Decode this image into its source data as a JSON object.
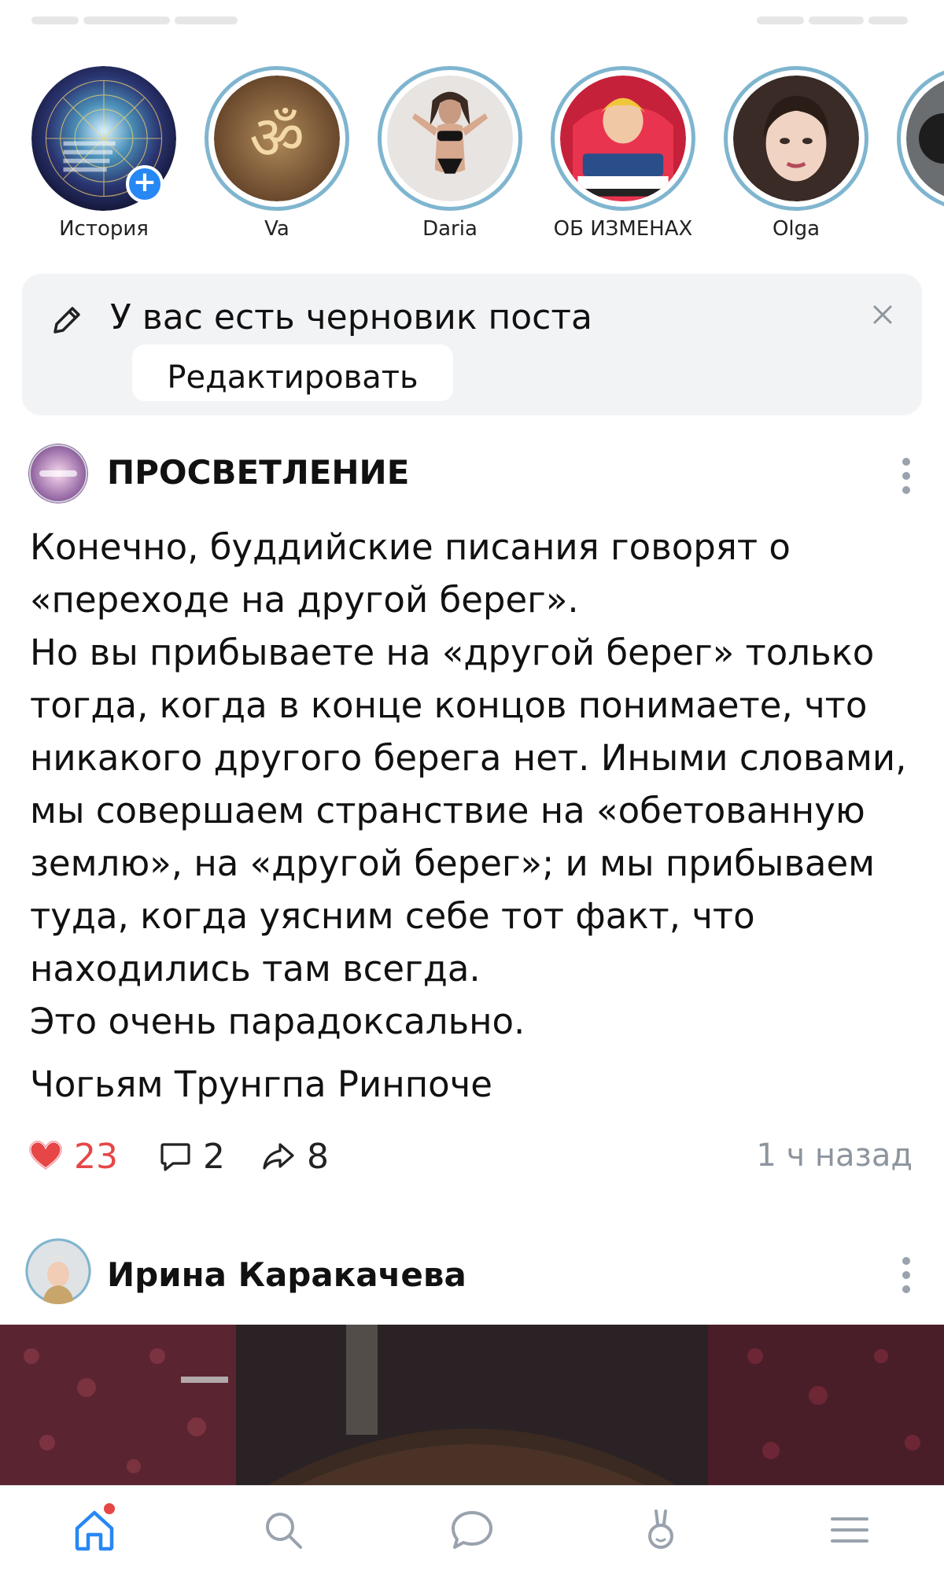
{
  "stories": [
    {
      "name": "История",
      "own": true
    },
    {
      "name": "Va"
    },
    {
      "name": "Daria"
    },
    {
      "name": "ОБ ИЗМЕНАХ"
    },
    {
      "name": "Olga"
    }
  ],
  "draft": {
    "text": "У вас есть черновик поста",
    "edit_label": "Редактировать"
  },
  "post": {
    "author": "ПРОСВЕТЛЕНИЕ",
    "paragraphs": [
      "Конечно, буддийские писания говорят о «переходе на другой берег».",
      "Но вы прибываете на «другой берег» только тогда, когда в конце концов понимаете, что никакого другого берега нет. Иными словами, мы совершаем странствие на «обетованную землю», на «другой берег»; и мы прибываем туда, когда уясним себе тот факт, что находились там всегда.",
      "Это очень парадоксально."
    ],
    "signature": "Чогьям Трунгпа Ринпоче",
    "likes": "23",
    "comments": "2",
    "shares": "8",
    "time": "1 ч назад"
  },
  "post2": {
    "author": "Ирина Каракачева"
  },
  "nav": {
    "items": [
      "home-icon",
      "search-icon",
      "messages-icon",
      "clips-icon",
      "menu-icon"
    ],
    "active": "home-icon"
  },
  "colors": {
    "accent": "#2787f5",
    "like": "#e64646",
    "story_ring": "#7fb5cf",
    "muted": "#8d959e",
    "nav_icon": "#99a2ad"
  }
}
